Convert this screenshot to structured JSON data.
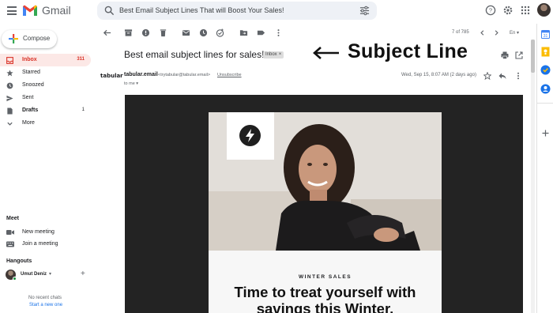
{
  "app": {
    "name": "Gmail"
  },
  "search": {
    "value": "Best Email Subject Lines That will Boost Your Sales!"
  },
  "compose": {
    "label": "Compose"
  },
  "nav": {
    "items": [
      {
        "label": "Inbox",
        "count": "311",
        "icon": "inbox-icon"
      },
      {
        "label": "Starred",
        "count": "",
        "icon": "star-icon"
      },
      {
        "label": "Snoozed",
        "count": "",
        "icon": "clock-icon"
      },
      {
        "label": "Sent",
        "count": "",
        "icon": "send-icon"
      },
      {
        "label": "Drafts",
        "count": "1",
        "icon": "draft-icon"
      },
      {
        "label": "More",
        "count": "",
        "icon": "chevron-down-icon"
      }
    ]
  },
  "meet": {
    "title": "Meet",
    "new_meeting": "New meeting",
    "join_meeting": "Join a meeting"
  },
  "hangouts": {
    "title": "Hangouts",
    "user": "Umut Deniz",
    "no_chats": "No recent chats",
    "start_new": "Start a new one"
  },
  "toolbar": {
    "pager": "7 of 785",
    "language": "En"
  },
  "message": {
    "subject": "Best email subject lines for sales!",
    "label_chip": "Inbox",
    "sender_logo": "tabular",
    "sender_name": "tabular.email",
    "sender_email": "<trytabular@tabular.email>",
    "unsubscribe": "Unsubscribe",
    "to": "to me",
    "date": "Wed, Sep 15, 8:07 AM (2 days ago)"
  },
  "annotation": {
    "label": "Subject Line"
  },
  "email_body": {
    "eyebrow": "WINTER SALES",
    "headline_line1": "Time to treat yourself with",
    "headline_line2": "savings this Winter."
  },
  "colors": {
    "brand_red": "#d93025",
    "active_nav_bg": "#fce8e6",
    "link_blue": "#1a73e8",
    "email_dark_bg": "#232323"
  }
}
